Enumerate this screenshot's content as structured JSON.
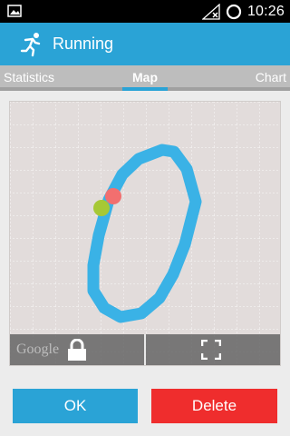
{
  "status_bar": {
    "time": "10:26",
    "icons": [
      "image-icon",
      "signal-icon",
      "circle-icon"
    ]
  },
  "app_bar": {
    "title": "Running",
    "icon": "running-person-icon"
  },
  "tabs": [
    {
      "label": "Statistics",
      "selected": false
    },
    {
      "label": "Map",
      "selected": true
    },
    {
      "label": "Chart",
      "selected": false
    }
  ],
  "map": {
    "attribution": "Google",
    "route_color": "#3ab2e6",
    "start_marker_color": "#a6c835",
    "end_marker_color": "#f26f6f",
    "toolbar_icons": [
      "lock-icon",
      "fullscreen-icon"
    ]
  },
  "buttons": {
    "ok_label": "OK",
    "delete_label": "Delete"
  },
  "colors": {
    "accent": "#2aa3d6",
    "danger": "#ef2d2d"
  }
}
